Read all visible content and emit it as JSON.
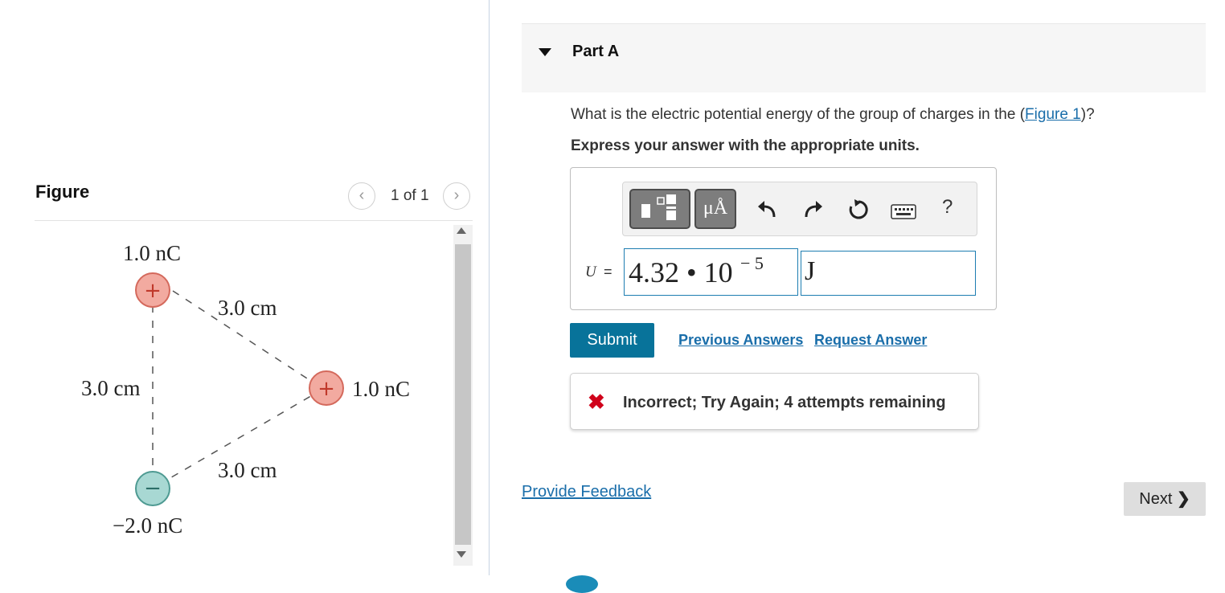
{
  "figure": {
    "title": "Figure",
    "prev_icon": "chevron-left-icon",
    "next_icon": "chevron-right-icon",
    "page_counter": "1 of 1",
    "charges": [
      {
        "label": "1.0 nC",
        "sign": "+",
        "color": "#f2aaa0"
      },
      {
        "label": "1.0 nC",
        "sign": "+",
        "color": "#f2aaa0"
      },
      {
        "label": "−2.0 nC",
        "sign": "−",
        "color": "#a8d8d3"
      }
    ],
    "distances": [
      "3.0 cm",
      "3.0 cm",
      "3.0 cm"
    ]
  },
  "part": {
    "title": "Part A",
    "question_before": "What is the electric potential energy of the group of charges in the (",
    "question_link": "Figure 1",
    "question_after": ")?",
    "instruction": "Express your answer with the appropriate units."
  },
  "toolbar": {
    "template_icon": "fraction-template-icon",
    "units_label": "μÅ",
    "undo_icon": "undo-icon",
    "redo_icon": "redo-icon",
    "reset_icon": "reset-icon",
    "keyboard_icon": "keyboard-icon",
    "help_label": "?"
  },
  "answer": {
    "variable": "U",
    "equals": "=",
    "value": "4.32 • 10",
    "exponent": "− 5",
    "units": "J"
  },
  "actions": {
    "submit": "Submit",
    "previous_answers": "Previous Answers",
    "request_answer": "Request Answer"
  },
  "feedback": {
    "icon": "x-icon",
    "message": "Incorrect; Try Again; 4 attempts remaining"
  },
  "footer": {
    "provide_feedback": "Provide Feedback",
    "next": "Next",
    "next_icon": "chevron-right-icon"
  },
  "colors": {
    "link": "#1a6eaa",
    "submit_bg": "#08739a",
    "error": "#d0021b",
    "positive_charge": "#f2aaa0",
    "negative_charge": "#a8d8d3"
  }
}
